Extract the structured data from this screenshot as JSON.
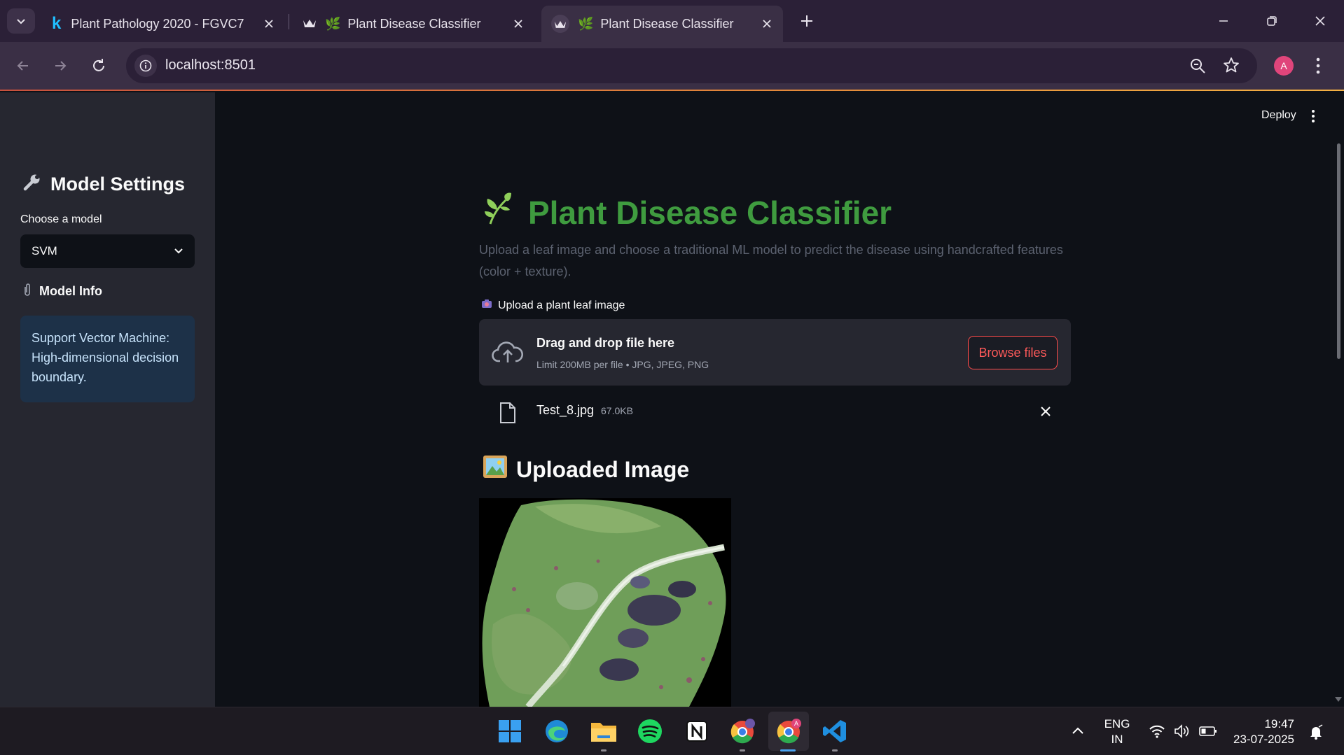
{
  "browser": {
    "tabs": [
      {
        "label": "Plant Pathology 2020 - FGVC7 |",
        "active": false
      },
      {
        "label": "Plant Disease Classifier",
        "active": false
      },
      {
        "label": "Plant Disease Classifier",
        "active": true
      }
    ],
    "url": "localhost:8501",
    "profile_initial": "A",
    "accent_colors": {
      "titlebar": "#2b2037",
      "toolbar": "#3a2f45",
      "profile": "#e0457b"
    }
  },
  "app_header": {
    "deploy_label": "Deploy"
  },
  "sidebar": {
    "title": "Model Settings",
    "title_icon": "wrench-icon",
    "select_label": "Choose a model",
    "select_value": "SVM",
    "info_heading": "Model Info",
    "info_icon": "paperclip-icon",
    "info_text": "Support Vector Machine: High-dimensional decision boundary."
  },
  "main": {
    "title": "Plant Disease Classifier",
    "title_icon": "seedling-icon",
    "title_color": "#3f9b3f",
    "caption": "Upload a leaf image and choose a traditional ML model to predict the disease using handcrafted features (color + texture).",
    "upload_label": "Upload a plant leaf image",
    "upload_icon": "camera-icon",
    "dropzone_title": "Drag and drop file here",
    "dropzone_limit": "Limit 200MB per file • JPG, JPEG, PNG",
    "browse_label": "Browse files",
    "uploaded_file": {
      "name": "Test_8.jpg",
      "size": "67.0KB"
    },
    "image_heading": "Uploaded Image",
    "image_heading_icon": "framed-picture-icon"
  },
  "taskbar": {
    "apps": [
      "windows-start",
      "edge",
      "file-explorer",
      "spotify",
      "notion",
      "chrome-profile-1",
      "chrome-profile-2",
      "vscode"
    ],
    "language": "ENG",
    "region": "IN",
    "time": "19:47",
    "date": "23-07-2025"
  }
}
